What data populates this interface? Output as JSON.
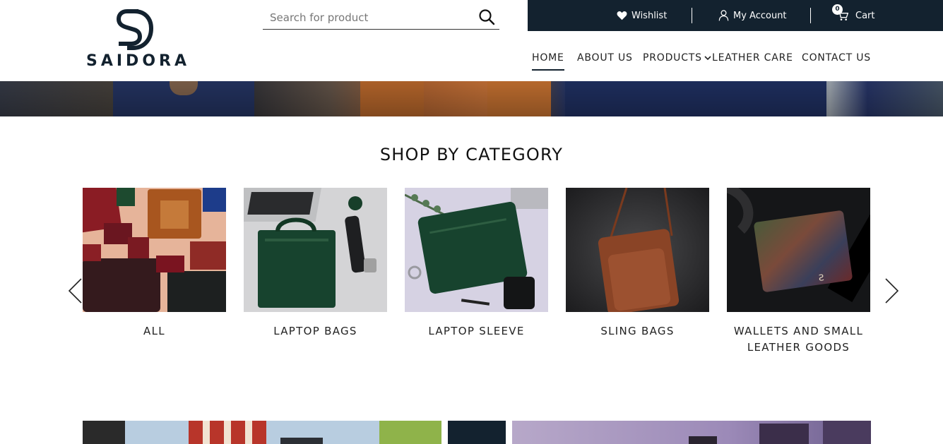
{
  "brand": {
    "name": "SAIDORA",
    "logo_mark": "SD"
  },
  "search": {
    "placeholder": "Search for product",
    "icon": "search-icon"
  },
  "topbar": {
    "wishlist_label": "Wishlist",
    "account_label": "My Account",
    "cart_label": "Cart",
    "cart_count": "0",
    "bg_color": "#13222f"
  },
  "nav": {
    "items": [
      {
        "label": "HOME",
        "active": true
      },
      {
        "label": "ABOUT US"
      },
      {
        "label": "PRODUCTS",
        "has_dropdown": true
      },
      {
        "label": "LEATHER CARE"
      },
      {
        "label": "CONTACT US"
      }
    ]
  },
  "section": {
    "title": "SHOP BY CATEGORY"
  },
  "categories": [
    {
      "label": "ALL"
    },
    {
      "label": "LAPTOP BAGS"
    },
    {
      "label": "LAPTOP SLEEVE"
    },
    {
      "label": "SLING BAGS"
    },
    {
      "label": "WALLETS AND SMALL LEATHER GOODS"
    }
  ],
  "colors": {
    "accent": "#13222f",
    "text": "#222222"
  }
}
